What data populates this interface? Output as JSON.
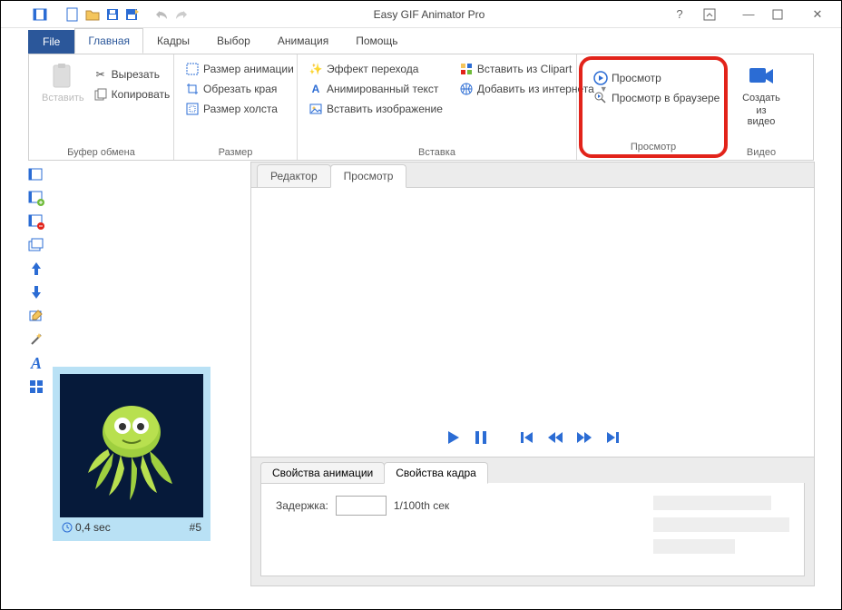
{
  "app": {
    "title": "Easy GIF Animator Pro"
  },
  "tabs": {
    "file": "File",
    "home": "Главная",
    "frames": "Кадры",
    "selection": "Выбор",
    "animation": "Анимация",
    "help": "Помощь"
  },
  "ribbon": {
    "clipboard": {
      "title": "Буфер обмена",
      "paste": "Вставить",
      "cut": "Вырезать",
      "copy": "Копировать"
    },
    "size": {
      "title": "Размер",
      "anim_size": "Размер анимации",
      "crop": "Обрезать края",
      "canvas_size": "Размер холста"
    },
    "insert": {
      "title": "Вставка",
      "transition": "Эффект перехода",
      "anim_text": "Анимированный текст",
      "insert_image": "Вставить изображение",
      "clipart": "Вставить из Clipart",
      "from_web": "Добавить из интернета"
    },
    "preview": {
      "title": "Просмотр",
      "preview": "Просмотр",
      "browser_preview": "Просмотр в браузере"
    },
    "video": {
      "title": "Видео",
      "from_video_line1": "Создать",
      "from_video_line2": "из видео"
    }
  },
  "main": {
    "tabs": {
      "editor": "Редактор",
      "preview": "Просмотр"
    },
    "props": {
      "tabs": {
        "anim": "Свойства анимации",
        "frame": "Свойства кадра"
      },
      "delay_label": "Задержка:",
      "delay_value": "",
      "delay_unit": "1/100th сек"
    }
  },
  "frame": {
    "time": "0,4 sec",
    "index": "#5"
  },
  "colors": {
    "accent": "#2b6cd4",
    "file_bg": "#2b579a",
    "highlight": "#e2231a"
  }
}
